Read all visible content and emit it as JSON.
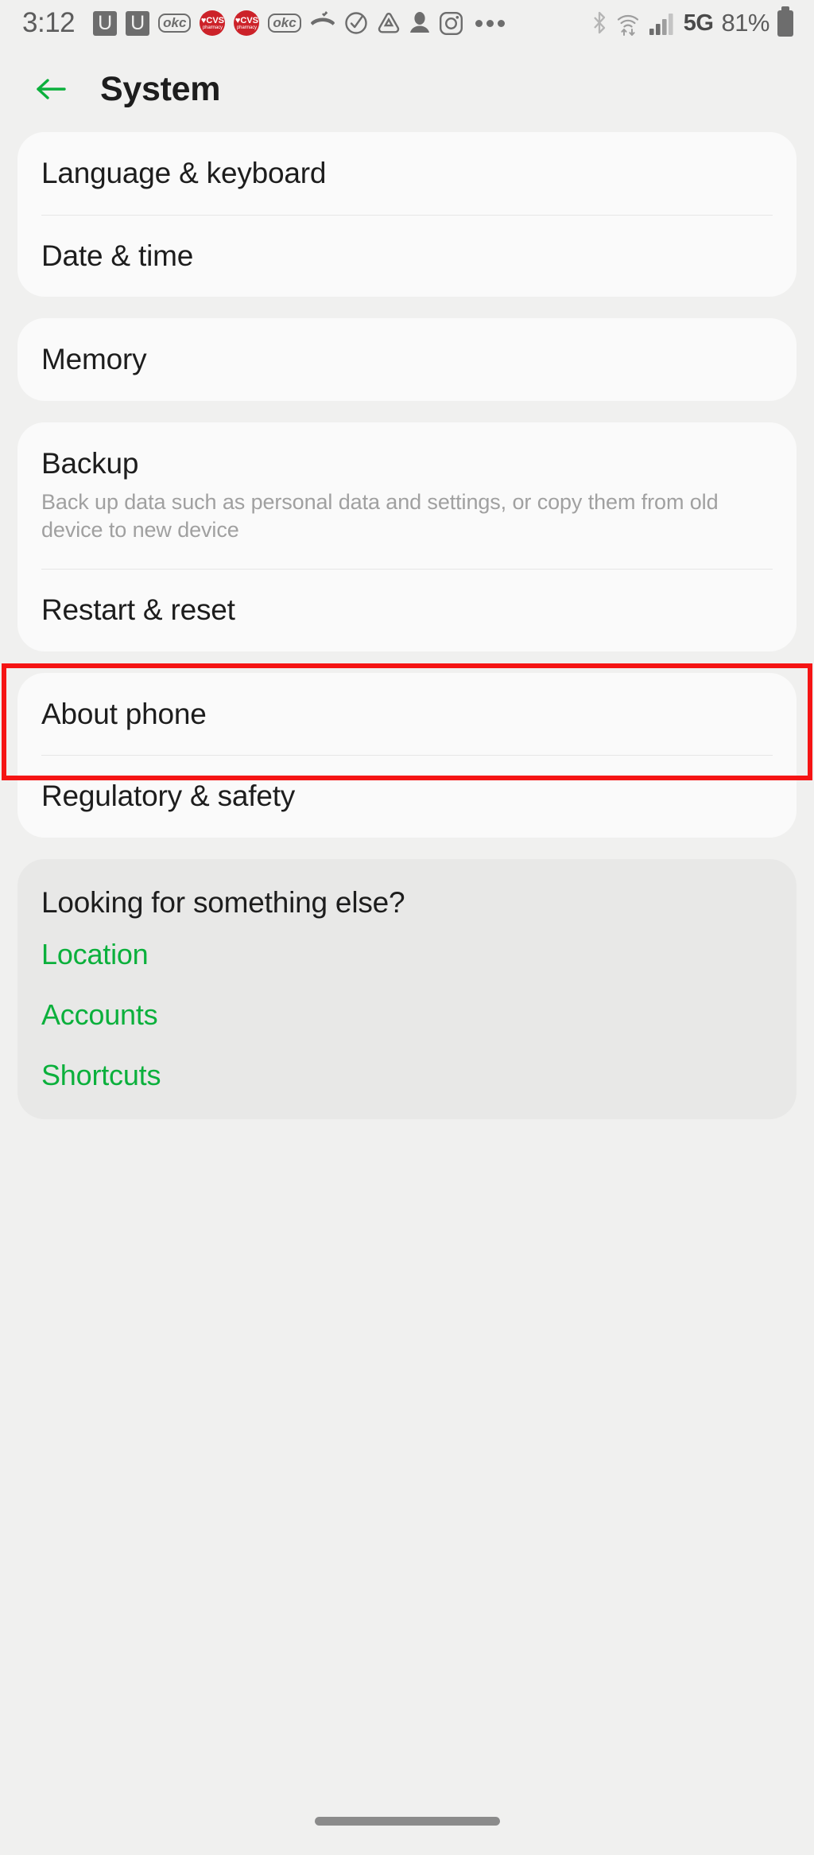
{
  "status_bar": {
    "time": "3:12",
    "left_icons": [
      {
        "name": "uber-notification-icon",
        "glyph": "U"
      },
      {
        "name": "uber-notification-icon-2",
        "glyph": "U"
      },
      {
        "name": "okcupid-notification-icon",
        "glyph": "okc"
      },
      {
        "name": "cvs-pharmacy-notification-icon",
        "glyph": "CVS",
        "sub": "pharmacy"
      },
      {
        "name": "cvs-pharmacy-notification-icon-2",
        "glyph": "CVS",
        "sub": "pharmacy"
      },
      {
        "name": "okcupid-notification-icon-2",
        "glyph": "okc"
      },
      {
        "name": "missed-call-icon",
        "glyph": "missed-call"
      },
      {
        "name": "task-check-icon",
        "glyph": "check-circle"
      },
      {
        "name": "alert-triangle-icon",
        "glyph": "triangle"
      },
      {
        "name": "contact-person-icon",
        "glyph": "person"
      },
      {
        "name": "instagram-icon",
        "glyph": "instagram"
      },
      {
        "name": "more-notifications-icon",
        "glyph": "dots"
      }
    ],
    "right_icons": [
      {
        "name": "bluetooth-icon"
      },
      {
        "name": "wifi-data-icon"
      },
      {
        "name": "cellular-signal-icon"
      }
    ],
    "network_type": "5G",
    "battery_percent": "81%"
  },
  "header": {
    "back_label": "Back",
    "title": "System"
  },
  "groups": [
    {
      "id": "group-locale",
      "rows": [
        {
          "name": "language-keyboard",
          "title": "Language & keyboard"
        },
        {
          "name": "date-time",
          "title": "Date & time"
        }
      ]
    },
    {
      "id": "group-memory",
      "rows": [
        {
          "name": "memory",
          "title": "Memory"
        }
      ]
    },
    {
      "id": "group-backup",
      "rows": [
        {
          "name": "backup",
          "title": "Backup",
          "subtitle": "Back up data such as personal data and settings, or copy them from old device to new device"
        },
        {
          "name": "restart-reset",
          "title": "Restart & reset"
        }
      ]
    },
    {
      "id": "group-about",
      "highlighted": true,
      "rows": [
        {
          "name": "about-phone",
          "title": "About phone"
        },
        {
          "name": "regulatory-safety",
          "title": "Regulatory & safety"
        }
      ]
    }
  ],
  "looking_for": {
    "title": "Looking for something else?",
    "links": [
      {
        "name": "location-link",
        "label": "Location"
      },
      {
        "name": "accounts-link",
        "label": "Accounts"
      },
      {
        "name": "shortcuts-link",
        "label": "Shortcuts"
      }
    ]
  },
  "colors": {
    "accent_green": "#0bb03c",
    "highlight_red": "#f51414",
    "background": "#f0f0ef",
    "card": "#fafafa",
    "card_alt": "#e8e8e7"
  }
}
